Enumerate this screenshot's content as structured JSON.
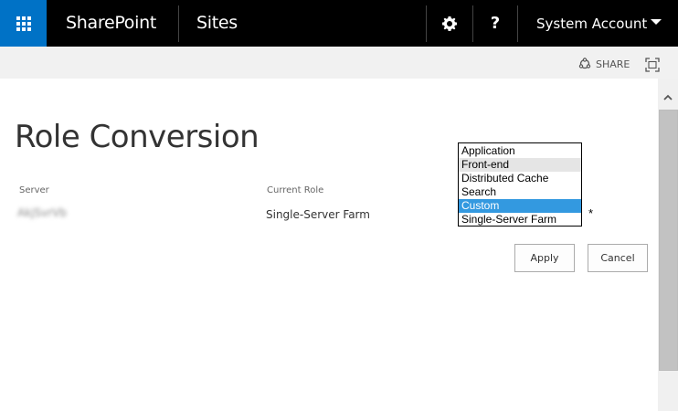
{
  "suitebar": {
    "brand": "SharePoint",
    "sites_label": "Sites",
    "help_label": "?",
    "account_name": "System Account"
  },
  "ribbon": {
    "share_label": "SHARE"
  },
  "page": {
    "title": "Role Conversion"
  },
  "table": {
    "headers": [
      "Server",
      "Current Role"
    ],
    "server_value": "AkjSvrVb",
    "current_role": "Single-Server Farm"
  },
  "role_select": {
    "options": [
      "Application",
      "Front-end",
      "Distributed Cache",
      "Search",
      "Custom",
      "Single-Server Farm"
    ],
    "selected": "Custom",
    "hovered": "Front-end",
    "required_marker": "*"
  },
  "buttons": {
    "apply_label": "Apply",
    "cancel_label": "Cancel"
  },
  "colors": {
    "suitebar_bg": "#000000",
    "app_launcher_bg": "#0072c6",
    "selection": "#3399e0",
    "ribbon_bg": "#f1f1f1"
  }
}
